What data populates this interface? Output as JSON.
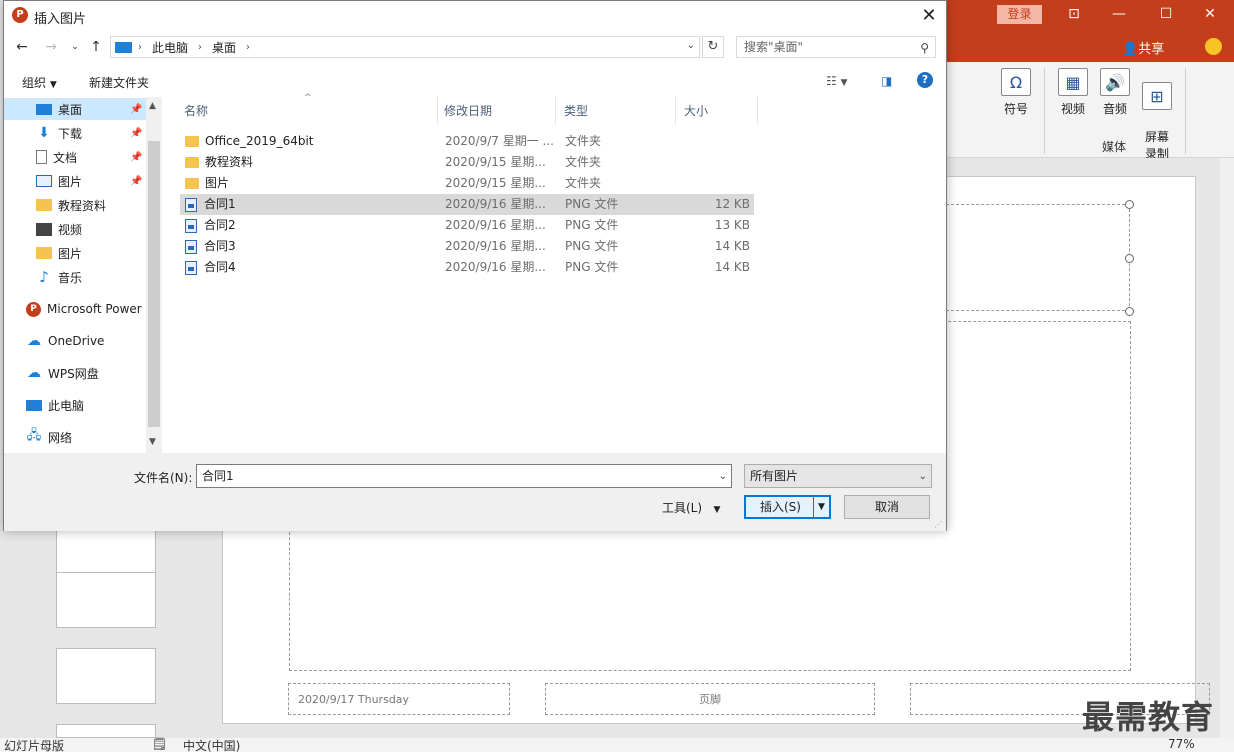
{
  "ppt": {
    "login_label": "登录",
    "share_label": "共享",
    "ribbon": {
      "symbol_label": "符号",
      "video_label": "视频",
      "audio_label": "音频",
      "screen_rec_label": "屏幕\n录制",
      "media_group": "媒体"
    },
    "slide": {
      "footer_date": "2020/9/17 Thursday",
      "footer_center": "页脚"
    },
    "status": {
      "view": "幻灯片母版",
      "language": "中文(中国)",
      "zoom": "77%"
    },
    "watermark": "最需教育",
    "accent": "#c43e1c"
  },
  "dialog": {
    "title": "插入图片",
    "address": {
      "seg1": "此电脑",
      "seg2": "桌面"
    },
    "search_placeholder": "搜索\"桌面\"",
    "toolbar": {
      "organize": "组织",
      "new_folder": "新建文件夹"
    },
    "nav_items": [
      {
        "label": "桌面"
      },
      {
        "label": "下载"
      },
      {
        "label": "文档"
      },
      {
        "label": "图片"
      },
      {
        "label": "教程资料"
      },
      {
        "label": "视频"
      },
      {
        "label": "图片"
      },
      {
        "label": "音乐"
      },
      {
        "label": "Microsoft Power"
      },
      {
        "label": "OneDrive"
      },
      {
        "label": "WPS网盘"
      },
      {
        "label": "此电脑"
      },
      {
        "label": "网络"
      }
    ],
    "columns": {
      "name": "名称",
      "date": "修改日期",
      "type": "类型",
      "size": "大小"
    },
    "files": [
      {
        "name": "Office_2019_64bit",
        "date": "2020/9/7 星期一 ...",
        "type": "文件夹",
        "size": ""
      },
      {
        "name": "教程资料",
        "date": "2020/9/15 星期...",
        "type": "文件夹",
        "size": ""
      },
      {
        "name": "图片",
        "date": "2020/9/15 星期...",
        "type": "文件夹",
        "size": ""
      },
      {
        "name": "合同1",
        "date": "2020/9/16 星期...",
        "type": "PNG 文件",
        "size": "12 KB"
      },
      {
        "name": "合同2",
        "date": "2020/9/16 星期...",
        "type": "PNG 文件",
        "size": "13 KB"
      },
      {
        "name": "合同3",
        "date": "2020/9/16 星期...",
        "type": "PNG 文件",
        "size": "14 KB"
      },
      {
        "name": "合同4",
        "date": "2020/9/16 星期...",
        "type": "PNG 文件",
        "size": "14 KB"
      }
    ],
    "filename_label": "文件名(N):",
    "filename_value": "合同1",
    "filter_value": "所有图片",
    "tools_label": "工具(L)",
    "insert_label": "插入(S)",
    "cancel_label": "取消"
  }
}
